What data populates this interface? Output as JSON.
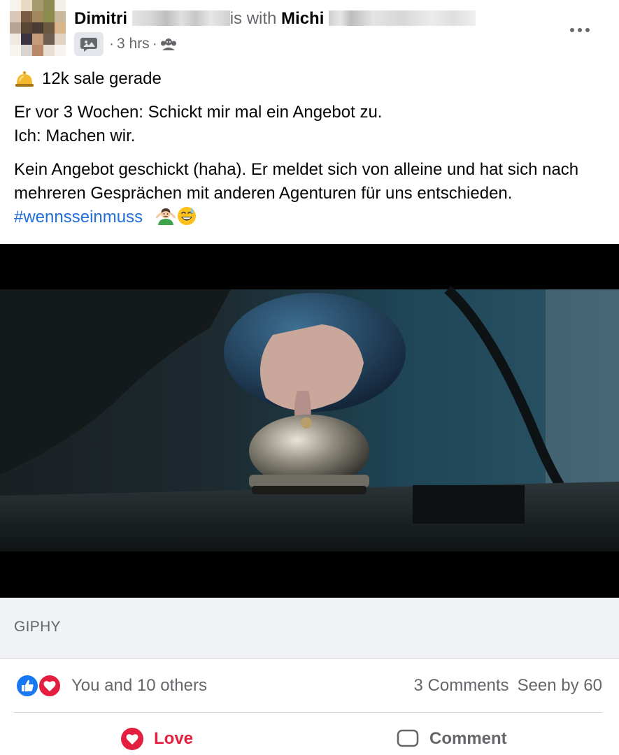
{
  "post": {
    "author": "Dimitri",
    "with_text": "is with",
    "tagged": "Michi",
    "time": "3 hrs",
    "dot": "·",
    "more_label": "•••",
    "line1": "12k sale gerade",
    "para2_line1": "Er vor 3 Wochen: Schickt mir mal ein Angebot zu.",
    "para2_line2": "Ich: Machen wir.",
    "para3_main": "Kein Angebot geschickt (haha). Er meldet sich von alleine und hat sich nach mehreren Gesprächen mit anderen Agenturen für uns entschieden. ",
    "hashtag": "#wennsseinmuss",
    "emojis": [
      "bellhop-bell",
      "person-shrugging",
      "grinning-face-with-sweat"
    ]
  },
  "media": {
    "source_label": "GIPHY"
  },
  "engagement": {
    "reactions_text": "You and 10 others",
    "comments": "3 Comments",
    "seen": "Seen by 60",
    "reaction_icons": [
      "like-icon",
      "love-icon"
    ]
  },
  "actions": {
    "love_label": "Love",
    "comment_label": "Comment"
  },
  "colors": {
    "like_blue": "#1877f2",
    "love_red": "#e41e3f",
    "hashtag_blue": "#216fdb",
    "secondary_text": "#65676b",
    "giphy_bg": "#f0f2f5"
  }
}
